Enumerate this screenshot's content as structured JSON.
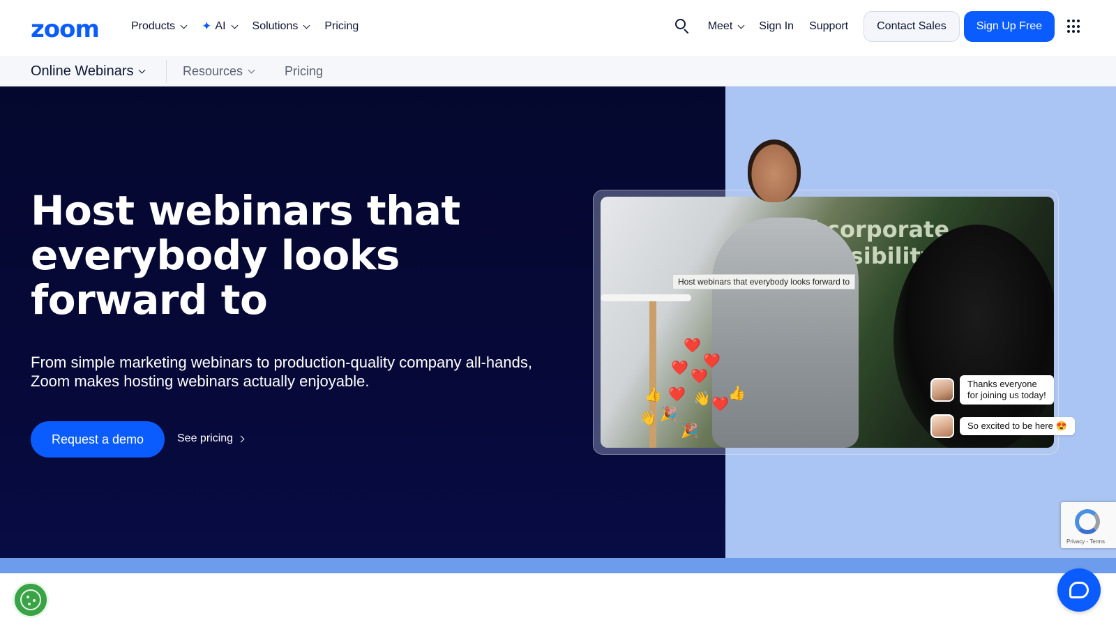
{
  "brand": {
    "logo_text": "zoom",
    "accent": "#0b5cff"
  },
  "topnav": {
    "left_items": [
      {
        "label": "Products",
        "has_dropdown": true
      },
      {
        "label": "AI",
        "has_dropdown": true,
        "icon": "sparkle-icon"
      },
      {
        "label": "Solutions",
        "has_dropdown": true
      },
      {
        "label": "Pricing",
        "has_dropdown": false
      }
    ],
    "right_items": [
      {
        "label": "Meet",
        "has_dropdown": true
      },
      {
        "label": "Sign In"
      },
      {
        "label": "Support"
      }
    ],
    "contact_sales": "Contact Sales",
    "sign_up": "Sign Up Free"
  },
  "subnav": {
    "title": "Online Webinars",
    "resources": "Resources",
    "pricing": "Pricing"
  },
  "hero": {
    "title": "Host webinars that everybody looks forward to",
    "subtitle": "From simple marketing webinars to production-quality company all-hands, Zoom makes hosting webinars actually enjoyable.",
    "cta_primary": "Request a demo",
    "cta_secondary": "See pricing",
    "dark_bg": "#05082e",
    "light_bg": "#aac5f4"
  },
  "video": {
    "screen_text": "d corporate\nponsibility",
    "caption": "Host webinars that everybody looks forward to",
    "chat": [
      {
        "message": "Thanks everyone\nfor joining us today!"
      },
      {
        "message": "So excited to be here 😍"
      }
    ],
    "reactions": [
      "❤️",
      "❤️",
      "❤️",
      "❤️",
      "👍",
      "❤️",
      "👋",
      "❤️",
      "👍",
      "👋",
      "🎉",
      "🎉"
    ]
  },
  "recaptcha": {
    "text": "Privacy - Terms"
  }
}
